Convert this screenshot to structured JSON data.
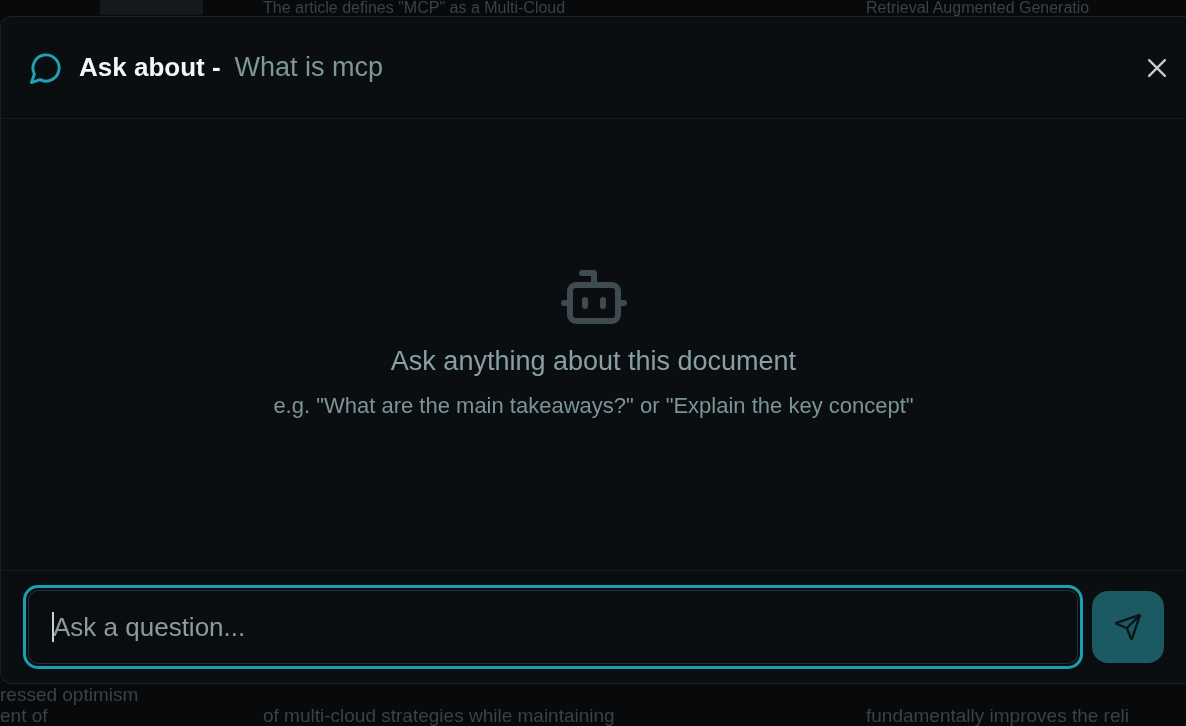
{
  "background_page": {
    "top_row": [
      {
        "kind": "photo"
      },
      {
        "kind": "text",
        "text": "The article defines \"MCP\" as a Multi-Cloud"
      },
      {
        "kind": "text",
        "text": "Retrieval Augmented Generatio"
      }
    ],
    "bottom_columns": [
      {
        "lines": [
          "ressed optimism",
          "ent of"
        ]
      },
      {
        "lines": [
          "of multi-cloud strategies while maintaining"
        ]
      },
      {
        "lines": [
          "fundamentally improves the reli"
        ]
      }
    ]
  },
  "dialog": {
    "title": "Ask about -",
    "document_title": "What is mcp",
    "empty_state": {
      "heading": "Ask anything about this document",
      "hint": "e.g. \"What are the main takeaways?\" or \"Explain the key concept\""
    },
    "composer": {
      "placeholder": "Ask a question...",
      "focused": true
    }
  }
}
